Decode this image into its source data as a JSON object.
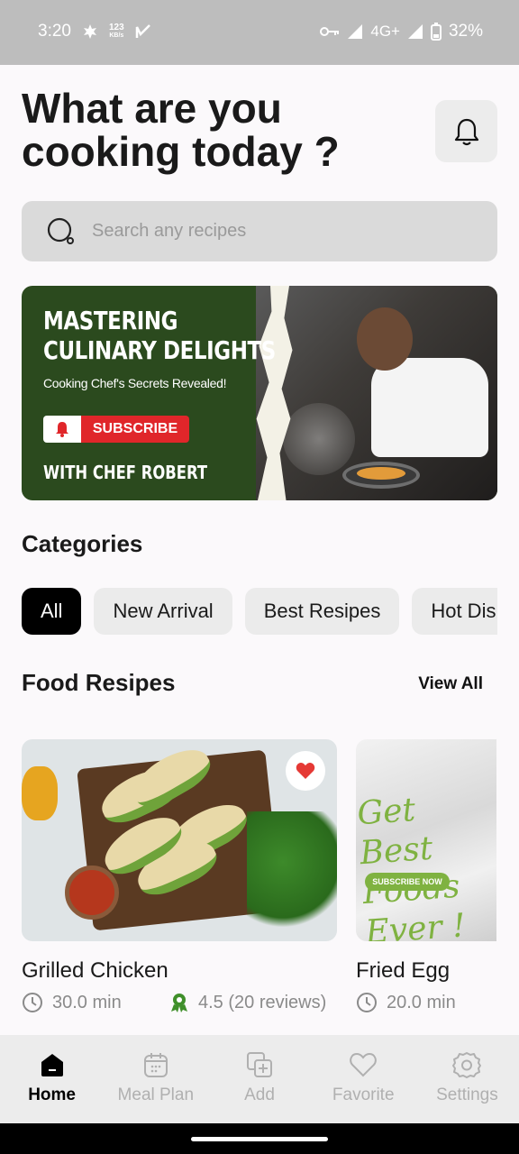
{
  "status_bar": {
    "time": "3:20",
    "speed_value": "123",
    "speed_unit": "KB/s",
    "network": "4G+",
    "battery": "32%"
  },
  "header": {
    "title": "What are you cooking today ?",
    "bell_icon": "bell-icon"
  },
  "search": {
    "placeholder": "Search any recipes",
    "value": ""
  },
  "banner": {
    "title_line1": "MASTERING",
    "title_line2": "CULINARY DELIGHTS",
    "subtitle": "Cooking Chef's Secrets Revealed!",
    "subscribe_label": "SUBSCRIBE",
    "chef_line": "WITH CHEF ROBERT"
  },
  "categories": {
    "heading": "Categories",
    "items": [
      {
        "label": "All",
        "active": true
      },
      {
        "label": "New Arrival",
        "active": false
      },
      {
        "label": "Best Resipes",
        "active": false
      },
      {
        "label": "Hot Dishes",
        "active": false
      }
    ]
  },
  "food_recipes": {
    "heading": "Food Resipes",
    "view_all": "View All",
    "cards": [
      {
        "name": "Grilled Chicken",
        "time": "30.0 min",
        "rating": "4.5 (20 reviews)",
        "favorite": true
      },
      {
        "name": "Fried Egg",
        "time": "20.0 min",
        "promo_text_line1": "Get Best",
        "promo_text_line2": "Foods Ever !",
        "promo_button": "SUBSCRIBE NOW"
      }
    ]
  },
  "bottom_nav": {
    "items": [
      {
        "label": "Home",
        "icon": "home-icon",
        "active": true
      },
      {
        "label": "Meal Plan",
        "icon": "calendar-icon",
        "active": false
      },
      {
        "label": "Add",
        "icon": "add-icon",
        "active": false
      },
      {
        "label": "Favorite",
        "icon": "heart-icon",
        "active": false
      },
      {
        "label": "Settings",
        "icon": "gear-icon",
        "active": false
      }
    ]
  },
  "colors": {
    "accent": "#000000",
    "banner_green": "#2b4a1e",
    "heart_red": "#e53935",
    "rating_green": "#3f8f2a"
  }
}
